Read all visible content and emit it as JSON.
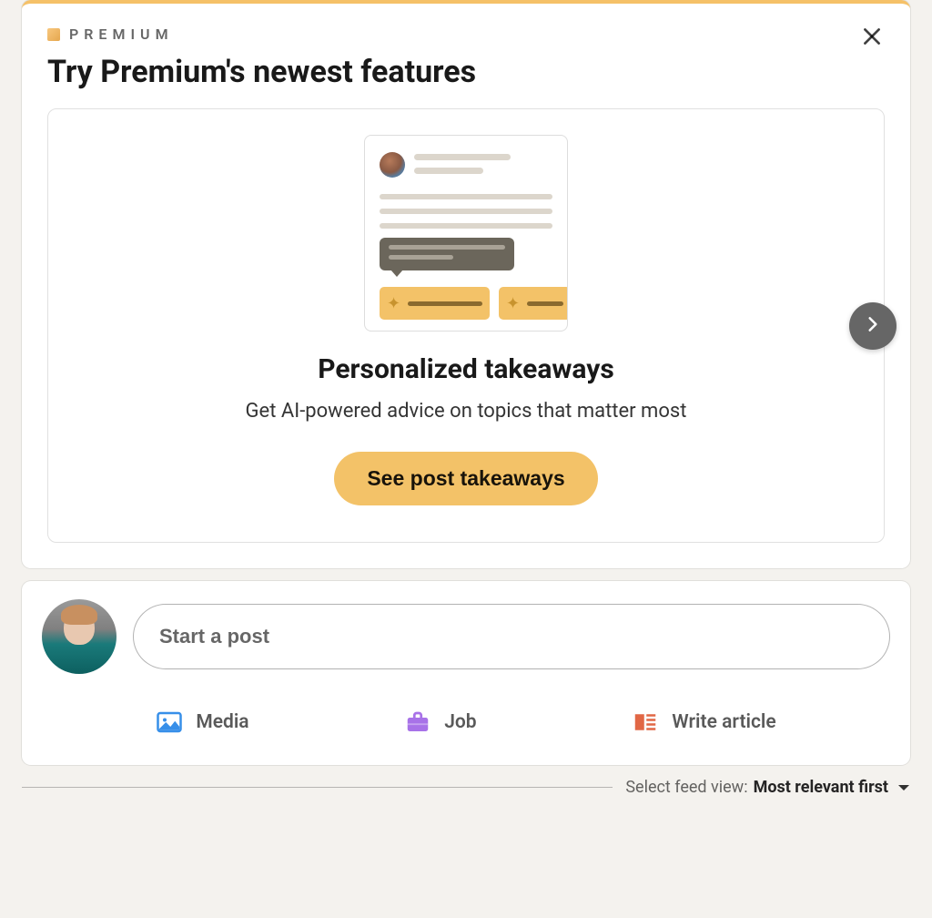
{
  "premium": {
    "badge_label": "PREMIUM",
    "title": "Try Premium's newest features",
    "feature": {
      "title": "Personalized takeaways",
      "description": "Get AI-powered advice on topics that matter most",
      "cta": "See post takeaways"
    }
  },
  "share": {
    "placeholder": "Start a post",
    "actions": {
      "media": "Media",
      "job": "Job",
      "article": "Write article"
    }
  },
  "feed_sort": {
    "label": "Select feed view:",
    "value": "Most relevant first"
  },
  "colors": {
    "premium_gold": "#f3c268",
    "media_blue": "#378fe9",
    "job_purple": "#a872e8",
    "article_orange": "#e16745"
  }
}
